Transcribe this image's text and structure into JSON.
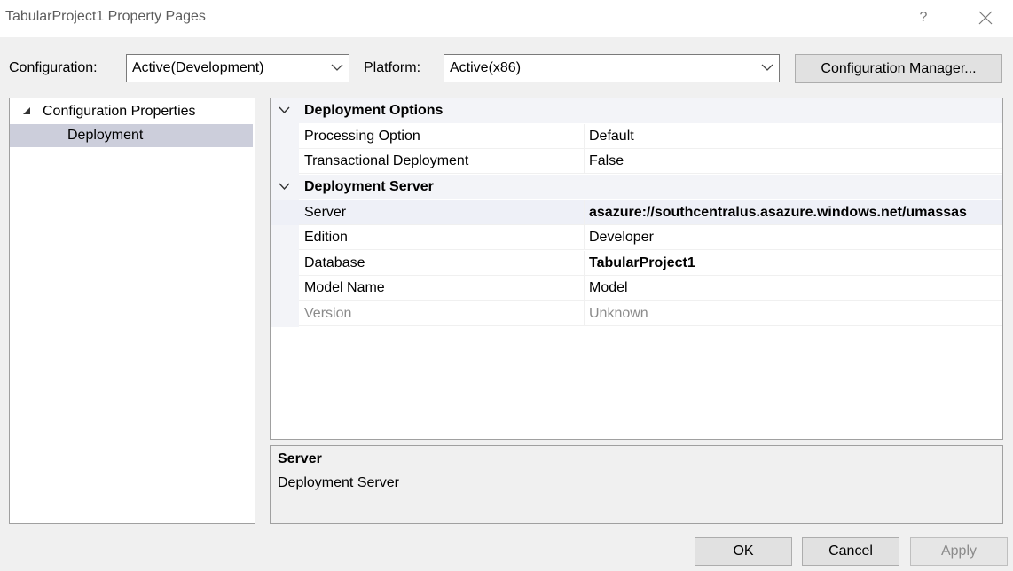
{
  "window": {
    "title": "TabularProject1 Property Pages",
    "help_icon": "question-mark-icon",
    "close_icon": "close-icon"
  },
  "toolbar": {
    "configuration_label": "Configuration:",
    "configuration_value": "Active(Development)",
    "platform_label": "Platform:",
    "platform_value": "Active(x86)",
    "config_manager_label": "Configuration Manager..."
  },
  "tree": {
    "root_label": "Configuration Properties",
    "child_label": "Deployment"
  },
  "grid": {
    "categories": [
      {
        "label": "Deployment Options",
        "rows": [
          {
            "name": "Processing Option",
            "value": "Default"
          },
          {
            "name": "Transactional Deployment",
            "value": "False"
          }
        ]
      },
      {
        "label": "Deployment Server",
        "rows": [
          {
            "name": "Server",
            "value": "asazure://southcentralus.asazure.windows.net/umassas"
          },
          {
            "name": "Edition",
            "value": "Developer"
          },
          {
            "name": "Database",
            "value": "TabularProject1"
          },
          {
            "name": "Model Name",
            "value": "Model"
          },
          {
            "name": "Version",
            "value": "Unknown"
          }
        ]
      }
    ]
  },
  "description": {
    "title": "Server",
    "body": "Deployment Server"
  },
  "buttons": {
    "ok": "OK",
    "cancel": "Cancel",
    "apply": "Apply"
  },
  "colors": {
    "selection": "#cccedb",
    "category_bg": "#f3f4f8",
    "disabled_text": "#8b8b8b"
  }
}
